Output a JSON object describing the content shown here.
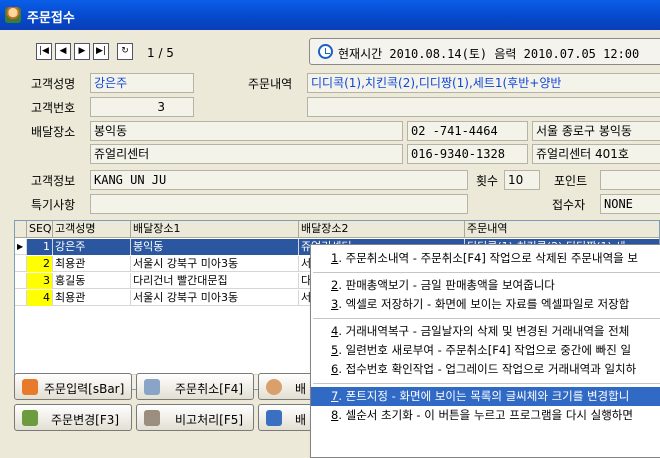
{
  "window": {
    "title": "주문접수"
  },
  "nav": {
    "first": "|◀",
    "prev": "◀",
    "next": "▶",
    "last": "▶|",
    "refresh": "↻",
    "page_info": "1 / 5"
  },
  "time_bar": {
    "text": "현재시간 2010.08.14(토) 음력 2010.07.05 12:00"
  },
  "form": {
    "customer_name_label": "고객성명",
    "customer_name": "강은주",
    "order_detail_label": "주문내역",
    "order_detail": "디디콕(1),치킨콕(2),디디짱(1),세트1(후반+양반",
    "customer_no_label": "고객번호",
    "customer_no": "3",
    "delivery_label": "배달장소",
    "address1": "봉익동",
    "phone1": "02 -741-4464",
    "address1b": "서울 종로구 봉익동",
    "address2": "쥬얼리센터",
    "phone2": "016-9340-1328",
    "address2b": "쥬얼리센터 401호",
    "customer_info_label": "고객정보",
    "customer_info": "KANG UN JU",
    "count_label": "횟수",
    "count": "10",
    "point_label": "포인트",
    "special_label": "특기사항",
    "receiver_label": "접수자",
    "receiver": "NONE"
  },
  "grid": {
    "columns": [
      "SEQ",
      "고객성명",
      "배달장소1",
      "배달장소2",
      "주문내역"
    ],
    "rows": [
      {
        "seq": "1",
        "name": "강은주",
        "addr1": "봉익동",
        "addr2": "쥬얼리센터",
        "order": "디디콕(1),치킨콕(2),디디짱(1),세"
      },
      {
        "seq": "2",
        "name": "최용관",
        "addr1": "서울시 강북구 미아3동",
        "addr2": "서",
        "order": ""
      },
      {
        "seq": "3",
        "name": "홍길동",
        "addr1": "다리건너 빨간대문집",
        "addr2": "다",
        "order": ""
      },
      {
        "seq": "4",
        "name": "최용관",
        "addr1": "서울시 강북구 미아3동",
        "addr2": "서",
        "order": ""
      }
    ]
  },
  "buttons": {
    "order_input": "주문입력[sBar]",
    "order_cancel": "주문취소[F4]",
    "delivery_partial": "배",
    "order_change": "주문변경[F3]",
    "remark": "비고처리[F5]",
    "delivery_partial2": "배"
  },
  "context_menu": {
    "items": [
      {
        "num": "1",
        "text": ". 주문취소내역 - 주문취소[F4] 작업으로 삭제된 주문내역을 보"
      },
      {
        "num": "2",
        "text": ". 판매총액보기 - 금일 판매총액을 보여줍니다"
      },
      {
        "num": "3",
        "text": ". 엑셀로 저장하기 - 화면에 보이는 자료를 엑셀파일로 저장합"
      },
      {
        "num": "4",
        "text": ". 거래내역복구 - 금일날자의 삭제 및 변경된 거래내역을 전체"
      },
      {
        "num": "5",
        "text": ". 일련번호 새로부여 -  주문취소[F4] 작업으로 중간에 빠진 일"
      },
      {
        "num": "6",
        "text": ". 접수번호 확인작업 - 업그레이드 작업으로 거래내역과 일치하"
      },
      {
        "num": "7",
        "text": ". 폰트지정 - 화면에 보이는  목록의 글씨체와 크기를 변경합니"
      },
      {
        "num": "8",
        "text": ". 셀순서 초기화 - 이 버튼을 누르고 프로그램을 다시 실행하면"
      }
    ]
  },
  "colors": {
    "titlebar": "#0a5ee8",
    "selected_row": "#2a57a0",
    "menu_highlight": "#316ac5",
    "seq_highlight": "#ffff00"
  }
}
